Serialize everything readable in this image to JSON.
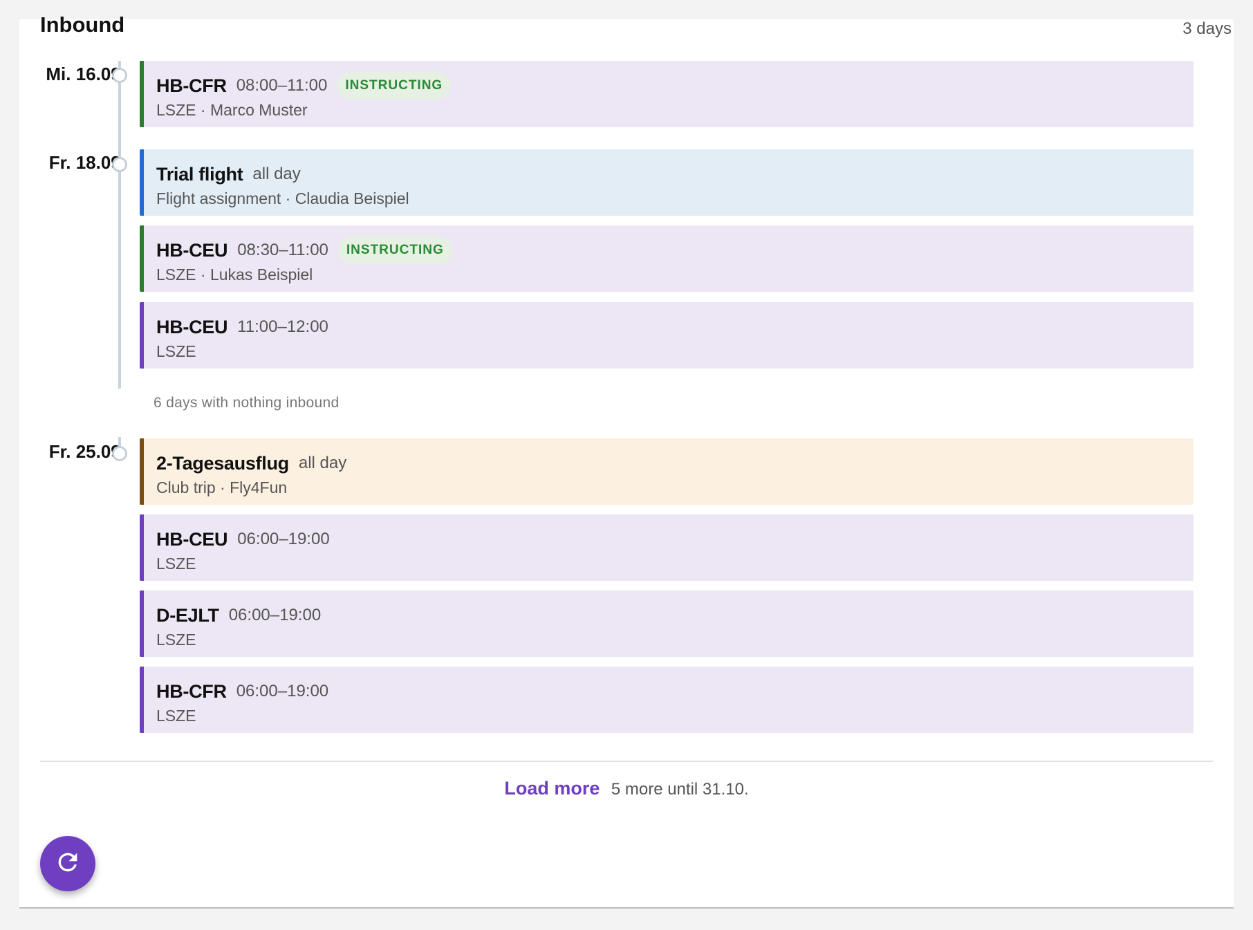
{
  "header": {
    "title": "Inbound",
    "range": "3 days"
  },
  "days": [
    {
      "date": "Mi. 16.09."
    },
    {
      "date": "Fr. 18.09."
    },
    {
      "date": "Fr. 25.09."
    }
  ],
  "events": [
    {
      "title": "HB-CFR",
      "time": "08:00–11:00",
      "badge": "INSTRUCTING",
      "sub": "LSZE · Marco Muster"
    },
    {
      "title": "Trial flight",
      "time": "all day",
      "sub": "Flight assignment · Claudia Beispiel"
    },
    {
      "title": "HB-CEU",
      "time": "08:30–11:00",
      "badge": "INSTRUCTING",
      "sub": "LSZE · Lukas Beispiel"
    },
    {
      "title": "HB-CEU",
      "time": "11:00–12:00",
      "sub": "LSZE"
    },
    {
      "title": "2-Tagesausflug",
      "time": "all day",
      "sub": "Club trip · Fly4Fun"
    },
    {
      "title": "HB-CEU",
      "time": "06:00–19:00",
      "sub": "LSZE"
    },
    {
      "title": "D-EJLT",
      "time": "06:00–19:00",
      "sub": "LSZE"
    },
    {
      "title": "HB-CFR",
      "time": "06:00–19:00",
      "sub": "LSZE"
    }
  ],
  "gap_note": "6 days with nothing inbound",
  "footer": {
    "load_more": "Load more",
    "info": "5 more until 31.10."
  },
  "colors": {
    "accent": "#6e3fc0",
    "instructing": "#2a7d2e",
    "assignment": "#1f6dd0",
    "club": "#7a4e12"
  },
  "icons": {
    "fab": "refresh-icon"
  }
}
